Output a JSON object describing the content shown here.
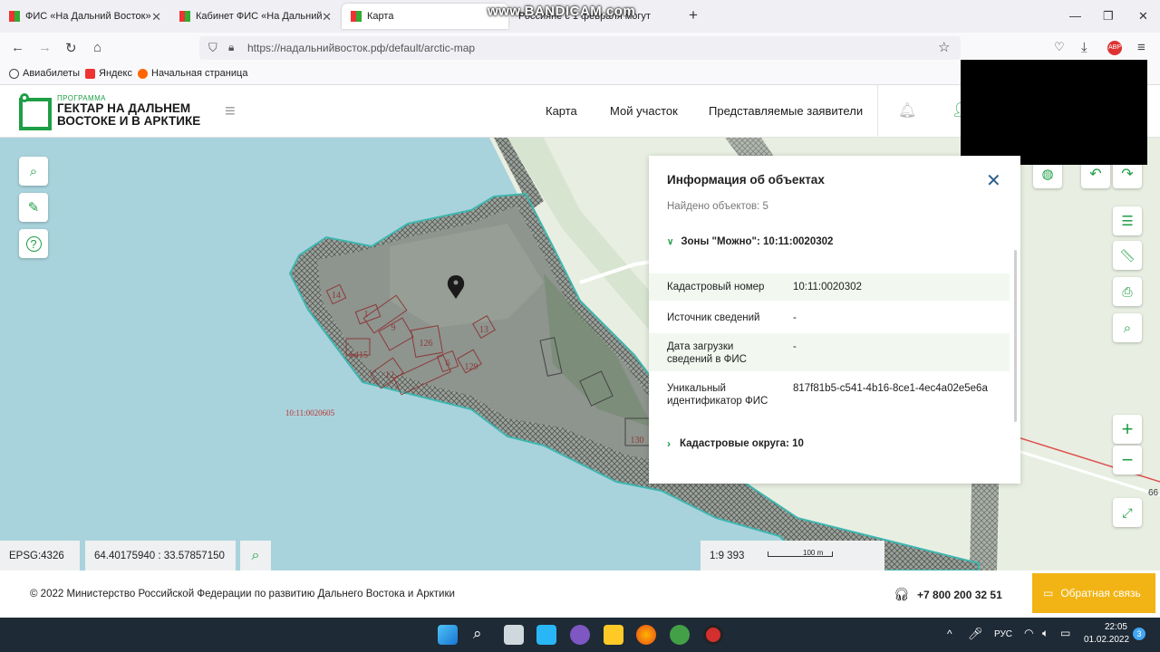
{
  "browser": {
    "tabs": [
      {
        "title": "ФИС «На Дальний Восток»"
      },
      {
        "title": "Кабинет ФИС «На Дальний Во"
      },
      {
        "title": "Карта"
      },
      {
        "title": "Россияне с 1 февраля могут"
      }
    ],
    "watermark": "www.BANDICAM.com",
    "url": "https://надальнийвосток.рф/default/arctic-map",
    "bookmarks": [
      "Авиабилеты",
      "Яндекс",
      "Начальная страница"
    ]
  },
  "site": {
    "logo_small": "ПРОГРАММА",
    "logo_line1": "ГЕКТАР НА ДАЛЬНЕМ",
    "logo_line2": "ВОСТОКЕ И В АРКТИКЕ",
    "nav": [
      "Карта",
      "Мой участок",
      "Представляемые заявители"
    ]
  },
  "map": {
    "parcel_labels": [
      "14",
      "1",
      "9",
      "6415",
      "126",
      "13",
      "12",
      "6",
      "129",
      "130"
    ],
    "cadastral_label": "10:11:0020605",
    "edge_label": "66",
    "epsg": "EPSG:4326",
    "coordinates": "64.40175940 : 33.57857150",
    "scale": "1:9 393",
    "scale_bar": "100 m"
  },
  "panel": {
    "title": "Информация об объектах",
    "found": "Найдено объектов: 5",
    "section1": "Зоны \"Можно\": 10:11:0020302",
    "rows": [
      {
        "key": "Кадастровый номер",
        "value": "10:11:0020302"
      },
      {
        "key": "Источник сведений",
        "value": "-"
      },
      {
        "key": "Дата загрузки сведений в ФИС",
        "value": "-"
      },
      {
        "key": "Уникальный идентификатор ФИС",
        "value": "817f81b5-c541-4b16-8ce1-4ec4a02e5e6a"
      }
    ],
    "section2": "Кадастровые округа: 10"
  },
  "footer": {
    "copyright": "© 2022 Министерство Российской Федерации по развитию Дальнего Востока и Арктики",
    "phone": "+7 800 200 32 51",
    "feedback": "Обратная связь"
  },
  "taskbar": {
    "lang": "РУС",
    "time": "22:05",
    "date": "01.02.2022",
    "badge": "3"
  },
  "colors": {
    "brand_green": "#1e9e45",
    "feedback_yellow": "#f2b414",
    "water": "#a9d3dc",
    "land": "#e8efe2"
  }
}
